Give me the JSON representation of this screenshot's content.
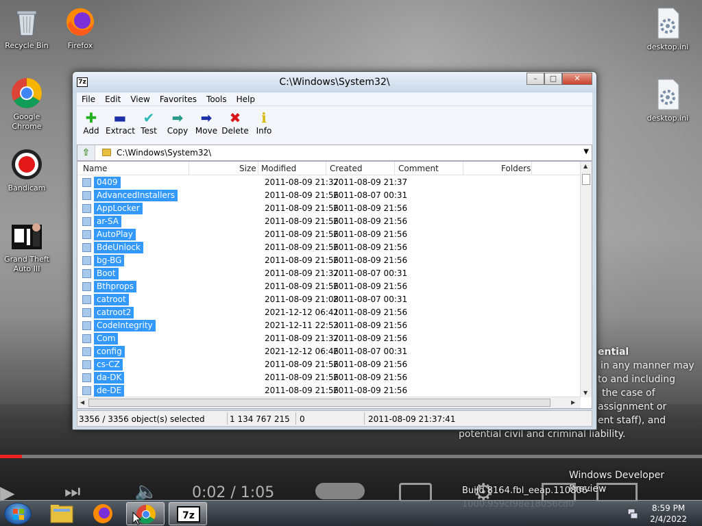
{
  "desktop": {
    "icons": [
      {
        "label": "Recycle Bin"
      },
      {
        "label": "Firefox"
      },
      {
        "label": "Google Chrome"
      },
      {
        "label": "Bandicam"
      },
      {
        "label": "Grand Theft Auto III"
      },
      {
        "label": "desktop.ini"
      },
      {
        "label": "desktop.ini"
      }
    ],
    "overlay_lines": [
      "ential",
      "in any manner may",
      "to and including",
      "the case of",
      "assignment or",
      "ent staff), and",
      "potential civil and criminal liability."
    ],
    "watermark_title": "Windows Developer Preview",
    "watermark_build": "Build 8164.fbl_eeap.110806-1000.959cf98e18056cd0",
    "video_time": "0:02 / 1:05",
    "video_progress": 0.031
  },
  "window": {
    "app_icon": "7z",
    "title": "C:\\Windows\\System32\\",
    "caption_buttons": {
      "minimize": "–",
      "maximize": "□",
      "close": "✕"
    },
    "menu": [
      "File",
      "Edit",
      "View",
      "Favorites",
      "Tools",
      "Help"
    ],
    "toolbar": [
      {
        "label": "Add",
        "icon": "plus-icon",
        "glyph": "✚",
        "color": "#22b022"
      },
      {
        "label": "Extract",
        "icon": "minus-icon",
        "glyph": "▬",
        "color": "#1a2fa8"
      },
      {
        "label": "Test",
        "icon": "check-icon",
        "glyph": "✔",
        "color": "#2ab8b8"
      },
      {
        "label": "Copy",
        "icon": "copy-arrow-icon",
        "glyph": "➡",
        "color": "#2a9a8a"
      },
      {
        "label": "Move",
        "icon": "move-arrow-icon",
        "glyph": "➡",
        "color": "#1a2fa8"
      },
      {
        "label": "Delete",
        "icon": "delete-x-icon",
        "glyph": "✖",
        "color": "#d81818"
      },
      {
        "label": "Info",
        "icon": "info-icon",
        "glyph": "ℹ",
        "color": "#d8b800"
      }
    ],
    "address": "C:\\Windows\\System32\\",
    "columns": [
      "Name",
      "Size",
      "Modified",
      "Created",
      "Comment",
      "Folders"
    ],
    "rows": [
      {
        "name": "0409",
        "modified": "2011-08-09 21:37",
        "created": "2011-08-09 21:37"
      },
      {
        "name": "AdvancedInstallers",
        "modified": "2011-08-09 21:56",
        "created": "2011-08-07 00:31"
      },
      {
        "name": "AppLocker",
        "modified": "2011-08-09 21:56",
        "created": "2011-08-09 21:56"
      },
      {
        "name": "ar-SA",
        "modified": "2011-08-09 21:56",
        "created": "2011-08-09 21:56"
      },
      {
        "name": "AutoPlay",
        "modified": "2011-08-09 21:56",
        "created": "2011-08-09 21:56"
      },
      {
        "name": "BdeUnlock",
        "modified": "2011-08-09 21:56",
        "created": "2011-08-09 21:56"
      },
      {
        "name": "bg-BG",
        "modified": "2011-08-09 21:56",
        "created": "2011-08-09 21:56"
      },
      {
        "name": "Boot",
        "modified": "2011-08-09 21:37",
        "created": "2011-08-07 00:31"
      },
      {
        "name": "Bthprops",
        "modified": "2011-08-09 21:56",
        "created": "2011-08-09 21:56"
      },
      {
        "name": "catroot",
        "modified": "2011-08-09 21:08",
        "created": "2011-08-07 00:31"
      },
      {
        "name": "catroot2",
        "modified": "2021-12-12 06:41",
        "created": "2011-08-09 21:56"
      },
      {
        "name": "CodeIntegrity",
        "modified": "2021-12-11 22:53",
        "created": "2011-08-09 21:56"
      },
      {
        "name": "Com",
        "modified": "2011-08-09 21:37",
        "created": "2011-08-09 21:56"
      },
      {
        "name": "config",
        "modified": "2021-12-12 06:46",
        "created": "2011-08-07 00:31"
      },
      {
        "name": "cs-CZ",
        "modified": "2011-08-09 21:56",
        "created": "2011-08-09 21:56"
      },
      {
        "name": "da-DK",
        "modified": "2011-08-09 21:56",
        "created": "2011-08-09 21:56"
      },
      {
        "name": "de-DE",
        "modified": "2011-08-09 21:56",
        "created": "2011-08-09 21:56"
      }
    ],
    "status": {
      "selection": "3356 / 3356 object(s) selected",
      "size": "1 134 767 215",
      "packed": "0",
      "date": "2011-08-09 21:37:41"
    }
  },
  "taskbar": {
    "time": "8:59 PM",
    "date": "2/4/2022"
  }
}
